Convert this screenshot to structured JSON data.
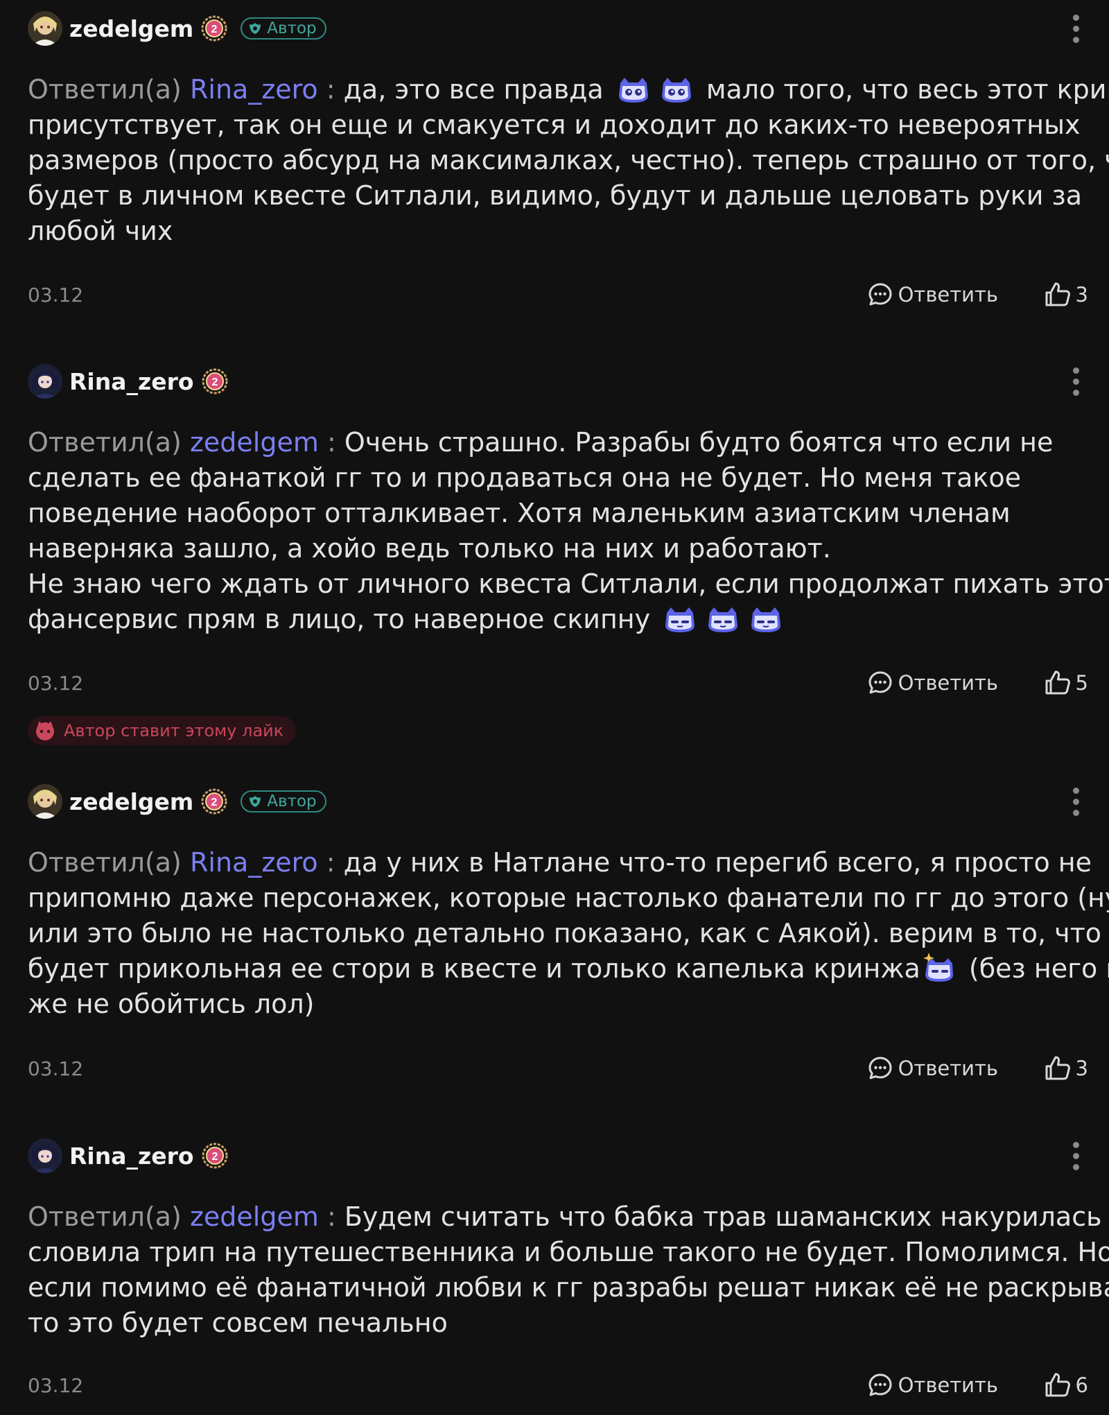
{
  "common": {
    "replied_prefix": "Ответил(а)",
    "reply_label": "Ответить",
    "author_badge": "Автор",
    "level": "2"
  },
  "comments": [
    {
      "username": "zedelgem",
      "is_author": true,
      "mention": "Rina_zero",
      "lines": [
        "да, это все правда",
        "мало того, что весь этот кринж",
        "присутствует, так он еще и смакуется и доходит до каких-то невероятных",
        "размеров (просто абсурд на максималках, честно). теперь страшно от того, что",
        "будет в личном квесте Ситлали, видимо, будут и дальше целовать руки за",
        "любой чих"
      ],
      "date": "03.12",
      "likes": "3"
    },
    {
      "username": "Rina_zero",
      "is_author": false,
      "mention": "zedelgem",
      "lines": [
        "Очень страшно. Разрабы будто боятся что если не",
        "сделать ее фанаткой гг то и продаваться она не будет.  Но меня такое",
        "поведение наоборот отталкивает. Хотя маленьким азиатским членам",
        "наверняка зашло, а хойо ведь только на них и работают.",
        "Не знаю чего ждать от личного квеста Ситлали, если продолжат пихать этот",
        "фансервис прям в лицо, то наверное скипну"
      ],
      "date": "03.12",
      "likes": "5",
      "author_liked": "Автор ставит этому лайк"
    },
    {
      "username": "zedelgem",
      "is_author": true,
      "mention": "Rina_zero",
      "lines": [
        "да у них в Натлане что-то перегиб всего, я просто не",
        "припомню даже персонажек, которые настолько фанатели по гг до этого (ну",
        "или это было не настолько детально показано, как с Аякой). верим в то, что",
        "будет прикольная ее стори в квесте и только капелька кринжа",
        "(без него все",
        "же не обойтись лол)"
      ],
      "date": "03.12",
      "likes": "3"
    },
    {
      "username": "Rina_zero",
      "is_author": false,
      "mention": "zedelgem",
      "lines": [
        "Будем считать что бабка трав шаманских накурилась и",
        "словила трип на путешественника и больше такого не будет. Помолимся. Но",
        "если помимо её фанатичной любви к гг разрабы решат никак её не раскрывать,",
        "то это будет совсем печально"
      ],
      "date": "03.12",
      "likes": "6"
    }
  ],
  "icons": {
    "more": "more-vertical-icon",
    "reply": "comment-bubble-icon",
    "like": "thumbs-up-icon",
    "badge": "author-leaf-icon",
    "emoji": "paimon-emoji-icon",
    "heart": "heart-face-icon"
  },
  "colors": {
    "background": "#111111",
    "mention": "#7b7ff2",
    "author_badge": "#3fa89b",
    "author_liked": "#c9475c"
  }
}
